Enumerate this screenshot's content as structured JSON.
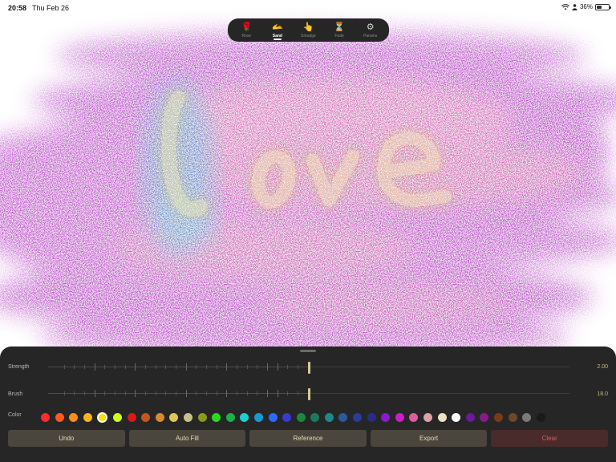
{
  "status": {
    "time": "20:58",
    "date": "Thu Feb 26",
    "battery": "36%"
  },
  "toolbar": {
    "tools": [
      {
        "label": "Rose",
        "icon": "🌹",
        "active": false
      },
      {
        "label": "Sand",
        "icon": "🫴",
        "active": true
      },
      {
        "label": "Smudge",
        "icon": "👆",
        "active": false
      },
      {
        "label": "Fade",
        "icon": "⏳",
        "active": false
      },
      {
        "label": "Params",
        "icon": "⚙",
        "active": false
      }
    ]
  },
  "canvas": {
    "description_text": "Love",
    "background_color": "#ffffff",
    "paint_color": "#a014b8",
    "text_color": "#e8dc7a"
  },
  "controls": {
    "strength": {
      "label": "Strength",
      "value": "2.00",
      "fraction": 0.5
    },
    "brush": {
      "label": "Brush",
      "value": "18.0",
      "fraction": 0.5
    },
    "color_label": "Color",
    "swatches": [
      "#ff2b2b",
      "#ff5a1a",
      "#ff8c1a",
      "#ffb21a",
      "#ffe000",
      "#ccff1a",
      "#d91a1a",
      "#c4561a",
      "#d98a2e",
      "#e0c850",
      "#c8c08a",
      "#8a9a1a",
      "#2bd91a",
      "#1ab04a",
      "#1ad0d0",
      "#1a9ad0",
      "#2b6aff",
      "#3a3ad0",
      "#1a8a3a",
      "#1a7a5a",
      "#1a8a8a",
      "#2b5a9a",
      "#2b3aa0",
      "#2b2a8a",
      "#8a1ad0",
      "#d01ad0",
      "#e05aa0",
      "#e0a0a8",
      "#f0e0c0",
      "#ffffff",
      "#6a1a9a",
      "#8a1a8a",
      "#7a3a1a",
      "#6a4a2a",
      "#7a7a7a",
      "#1a1a1a"
    ],
    "selected_swatch": 4
  },
  "buttons": {
    "undo": "Undo",
    "auto_fill": "Auto Fill",
    "reference": "Reference",
    "export": "Export",
    "clear": "Clear"
  }
}
